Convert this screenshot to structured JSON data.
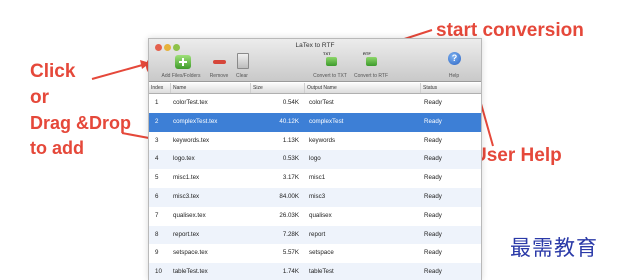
{
  "annotations": {
    "click": "Click",
    "or": "or",
    "drag_drop": "Drag &Drop",
    "to_add": "to add",
    "start_conversion": "start conversion",
    "user_help": "User Help",
    "color": "#e5483a"
  },
  "window": {
    "title": "LaTex to RTF"
  },
  "toolbar": {
    "add_label": "Add Files/Folders",
    "remove_label": "Remove",
    "clear_label": "Clear",
    "convert_txt_label": "Convert to TXT",
    "convert_txt_tag": "TXT",
    "convert_rtf_label": "Convert to RTF",
    "convert_rtf_tag": "RTF",
    "help_label": "Help",
    "help_glyph": "?"
  },
  "table": {
    "headers": {
      "index": "Index",
      "name": "Name",
      "size": "Size",
      "output": "Output Name",
      "status": "Status"
    },
    "selected_row": 1,
    "rows": [
      {
        "index": "1",
        "name": "colorTest.tex",
        "size": "0.54K",
        "output": "colorTest",
        "status": "Ready"
      },
      {
        "index": "2",
        "name": "complexTest.tex",
        "size": "40.12K",
        "output": "complexTest",
        "status": "Ready"
      },
      {
        "index": "3",
        "name": "keywords.tex",
        "size": "1.13K",
        "output": "keywords",
        "status": "Ready"
      },
      {
        "index": "4",
        "name": "logo.tex",
        "size": "0.53K",
        "output": "logo",
        "status": "Ready"
      },
      {
        "index": "5",
        "name": "misc1.tex",
        "size": "3.17K",
        "output": "misc1",
        "status": "Ready"
      },
      {
        "index": "6",
        "name": "misc3.tex",
        "size": "84.00K",
        "output": "misc3",
        "status": "Ready"
      },
      {
        "index": "7",
        "name": "qualisex.tex",
        "size": "26.03K",
        "output": "qualisex",
        "status": "Ready"
      },
      {
        "index": "8",
        "name": "report.tex",
        "size": "7.28K",
        "output": "report",
        "status": "Ready"
      },
      {
        "index": "9",
        "name": "setspace.tex",
        "size": "5.57K",
        "output": "setspace",
        "status": "Ready"
      },
      {
        "index": "10",
        "name": "tableTest.tex",
        "size": "1.74K",
        "output": "tableTest",
        "status": "Ready"
      }
    ]
  },
  "watermark": "最需教育"
}
